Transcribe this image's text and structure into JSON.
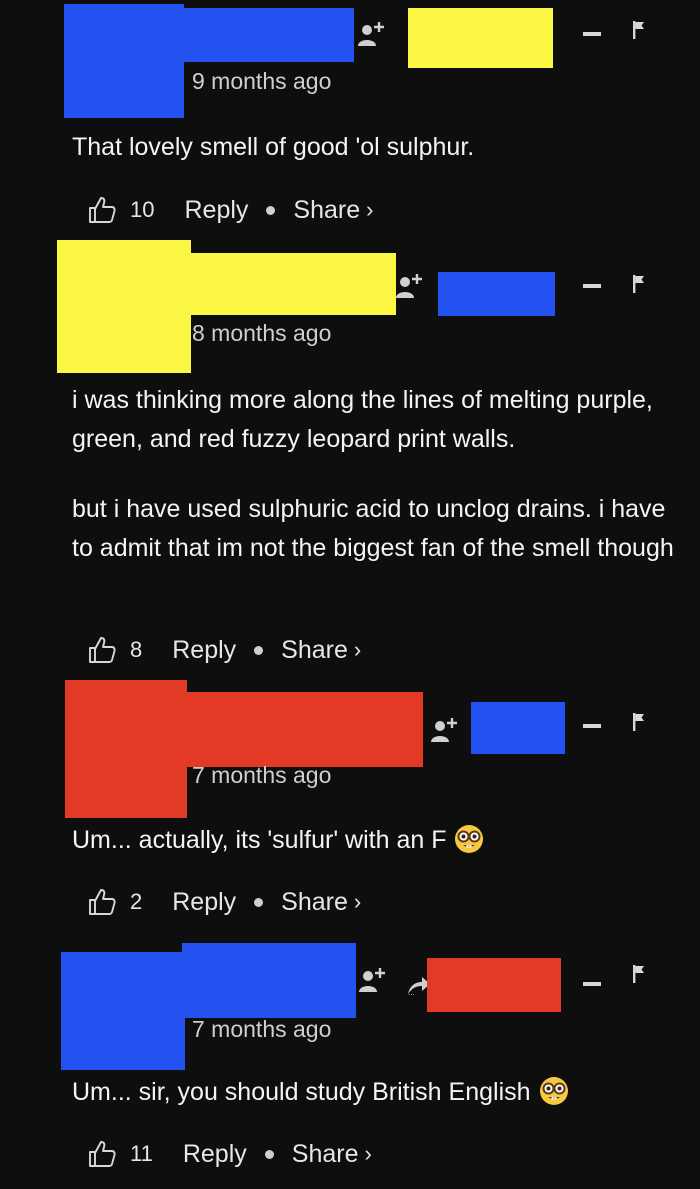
{
  "colors": {
    "background": "#0e0e0f",
    "blue": "#2352f0",
    "yellow": "#fbf744",
    "red": "#e33a25"
  },
  "comments": [
    {
      "time": "9 months ago",
      "text": [
        "That lovely smell of good 'ol sulphur."
      ],
      "likes": "10",
      "reply_label": "Reply",
      "share_label": "Share"
    },
    {
      "time": "8 months ago",
      "text": [
        "i was thinking more along the lines of melting purple, green, and red fuzzy leopard print walls.",
        "but i have used sulphuric acid to unclog drains. i have to admit that im not the biggest fan of the smell though"
      ],
      "likes": "8",
      "reply_label": "Reply",
      "share_label": "Share"
    },
    {
      "time": "7 months ago",
      "text": [
        "Um... actually, its 'sulfur' with an F"
      ],
      "emoji": "nerd-face-emoji",
      "likes": "2",
      "reply_label": "Reply",
      "share_label": "Share"
    },
    {
      "time": "7 months ago",
      "text": [
        "Um... sir, you should study British English"
      ],
      "emoji": "nerd-face-emoji",
      "likes": "11",
      "reply_label": "Reply",
      "share_label": "Share"
    }
  ],
  "icons": [
    "follow-icon",
    "reply-arrow-icon",
    "minus-icon",
    "flag-icon",
    "thumbs-up-icon",
    "chevron-right-icon",
    "nerd-face-emoji"
  ]
}
